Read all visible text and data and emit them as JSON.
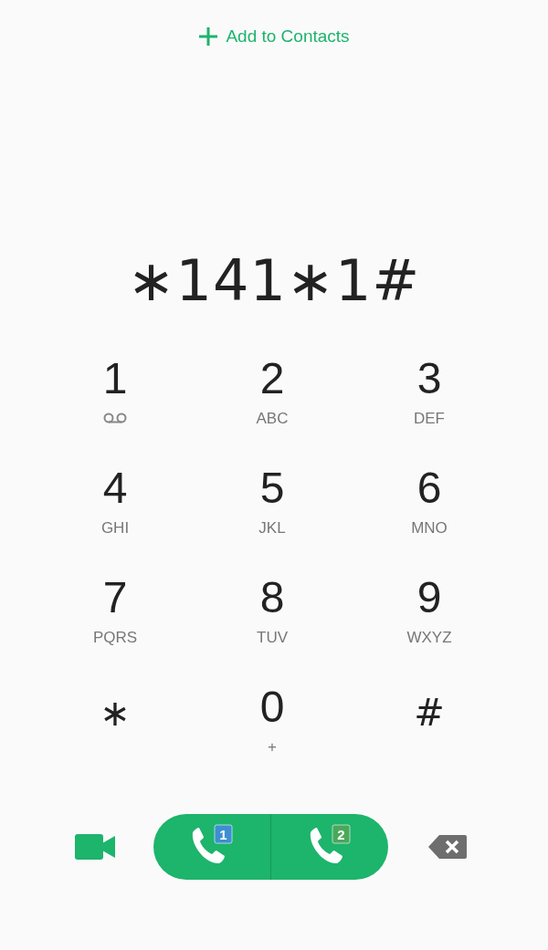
{
  "add_contact": {
    "label": "Add to Contacts"
  },
  "number": "∗141∗1#",
  "keys": [
    {
      "digit": "1",
      "kind": "voicemail"
    },
    {
      "digit": "2",
      "kind": "letters",
      "letters": "ABC"
    },
    {
      "digit": "3",
      "kind": "letters",
      "letters": "DEF"
    },
    {
      "digit": "4",
      "kind": "letters",
      "letters": "GHI"
    },
    {
      "digit": "5",
      "kind": "letters",
      "letters": "JKL"
    },
    {
      "digit": "6",
      "kind": "letters",
      "letters": "MNO"
    },
    {
      "digit": "7",
      "kind": "letters",
      "letters": "PQRS"
    },
    {
      "digit": "8",
      "kind": "letters",
      "letters": "TUV"
    },
    {
      "digit": "9",
      "kind": "letters",
      "letters": "WXYZ"
    },
    {
      "digit": "∗",
      "kind": "symbol"
    },
    {
      "digit": "0",
      "kind": "letters",
      "letters": "+"
    },
    {
      "digit": "#",
      "kind": "symbol"
    }
  ],
  "call_buttons": [
    {
      "sim": "1",
      "color": "#3d8fd1"
    },
    {
      "sim": "2",
      "color": "#4aa85a"
    }
  ]
}
